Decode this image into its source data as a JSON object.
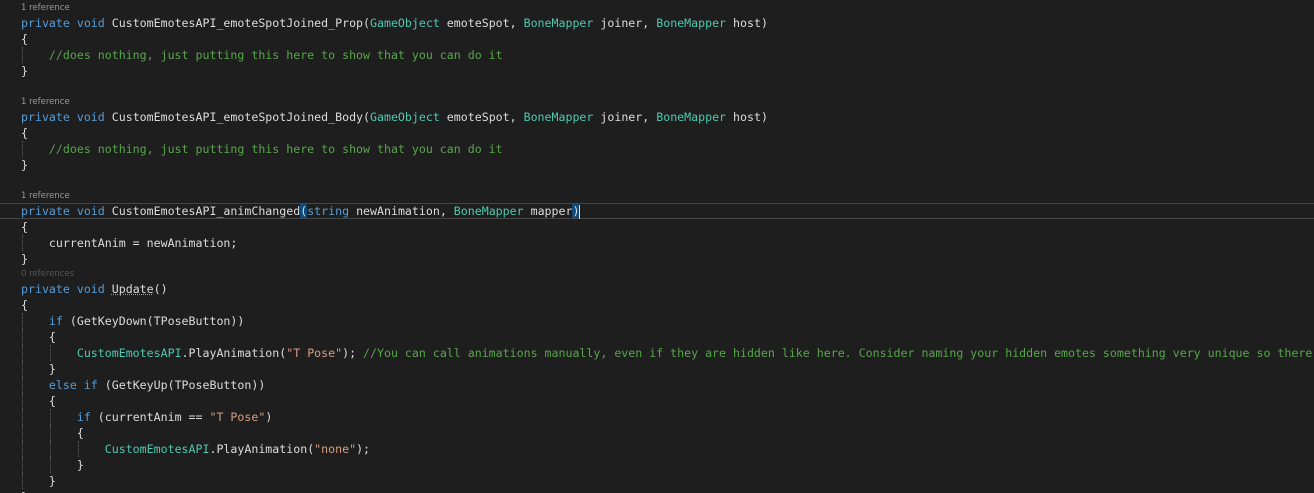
{
  "editor": {
    "theme_colors": {
      "keyword": "#569cd6",
      "type": "#4ec9b0",
      "comment": "#57a64a",
      "string": "#d69d85",
      "plain": "#dcdcdc",
      "background": "#1e1e1e"
    },
    "lines": [
      {
        "kind": "lens",
        "text": "1 reference"
      },
      {
        "kind": "code",
        "tokens": [
          [
            "k",
            "private void "
          ],
          [
            "p",
            "CustomEmotesAPI_emoteSpotJoined_Prop("
          ],
          [
            "t",
            "GameObject"
          ],
          [
            "p",
            " emoteSpot, "
          ],
          [
            "t",
            "BoneMapper"
          ],
          [
            "p",
            " joiner, "
          ],
          [
            "t",
            "BoneMapper"
          ],
          [
            "p",
            " host)"
          ]
        ]
      },
      {
        "kind": "code",
        "tokens": [
          [
            "p",
            "{"
          ]
        ]
      },
      {
        "kind": "code",
        "tokens": [
          [
            "p",
            "    "
          ],
          [
            "c",
            "//does nothing, just putting this here to show that you can do it"
          ]
        ]
      },
      {
        "kind": "code",
        "tokens": [
          [
            "p",
            "}"
          ]
        ]
      },
      {
        "kind": "code",
        "tokens": []
      },
      {
        "kind": "lens",
        "text": "1 reference"
      },
      {
        "kind": "code",
        "tokens": [
          [
            "k",
            "private void "
          ],
          [
            "p",
            "CustomEmotesAPI_emoteSpotJoined_Body("
          ],
          [
            "t",
            "GameObject"
          ],
          [
            "p",
            " emoteSpot, "
          ],
          [
            "t",
            "BoneMapper"
          ],
          [
            "p",
            " joiner, "
          ],
          [
            "t",
            "BoneMapper"
          ],
          [
            "p",
            " host)"
          ]
        ]
      },
      {
        "kind": "code",
        "tokens": [
          [
            "p",
            "{"
          ]
        ]
      },
      {
        "kind": "code",
        "tokens": [
          [
            "p",
            "    "
          ],
          [
            "c",
            "//does nothing, just putting this here to show that you can do it"
          ]
        ]
      },
      {
        "kind": "code",
        "tokens": [
          [
            "p",
            "}"
          ]
        ]
      },
      {
        "kind": "code",
        "tokens": []
      },
      {
        "kind": "lens",
        "text": "1 reference"
      },
      {
        "kind": "code",
        "current": true,
        "tokens": [
          [
            "k",
            "private void "
          ],
          [
            "p",
            "CustomEmotesAPI_animChanged"
          ],
          [
            "bm",
            "("
          ],
          [
            "k",
            "string"
          ],
          [
            "p",
            " newAnimation, "
          ],
          [
            "t",
            "BoneMapper"
          ],
          [
            "p",
            " mapper"
          ],
          [
            "bm",
            ")"
          ],
          [
            "caret",
            ""
          ]
        ]
      },
      {
        "kind": "code",
        "tokens": [
          [
            "p",
            "{"
          ]
        ]
      },
      {
        "kind": "code",
        "tokens": [
          [
            "p",
            "    currentAnim = newAnimation;"
          ]
        ]
      },
      {
        "kind": "code",
        "tokens": [
          [
            "p",
            "}"
          ]
        ]
      },
      {
        "kind": "lens",
        "dim": true,
        "text": "0 references"
      },
      {
        "kind": "code",
        "tokens": [
          [
            "k",
            "private void "
          ],
          [
            "u",
            "Update"
          ],
          [
            "p",
            "()"
          ]
        ]
      },
      {
        "kind": "code",
        "tokens": [
          [
            "p",
            "{"
          ]
        ]
      },
      {
        "kind": "code",
        "tokens": [
          [
            "p",
            "    "
          ],
          [
            "k",
            "if"
          ],
          [
            "p",
            " (GetKeyDown(TPoseButton))"
          ]
        ]
      },
      {
        "kind": "code",
        "tokens": [
          [
            "p",
            "    {"
          ]
        ]
      },
      {
        "kind": "code",
        "tokens": [
          [
            "p",
            "        "
          ],
          [
            "t",
            "CustomEmotesAPI"
          ],
          [
            "p",
            ".PlayAnimation("
          ],
          [
            "s",
            "\"T Pose\""
          ],
          [
            "p",
            "); "
          ],
          [
            "c",
            "//You can call animations manually, even if they are hidden like here. Consider naming your hidden emotes something very unique so there"
          ]
        ]
      },
      {
        "kind": "code",
        "tokens": [
          [
            "p",
            "    }"
          ]
        ]
      },
      {
        "kind": "code",
        "tokens": [
          [
            "p",
            "    "
          ],
          [
            "k",
            "else if"
          ],
          [
            "p",
            " (GetKeyUp(TPoseButton))"
          ]
        ]
      },
      {
        "kind": "code",
        "tokens": [
          [
            "p",
            "    {"
          ]
        ]
      },
      {
        "kind": "code",
        "tokens": [
          [
            "p",
            "        "
          ],
          [
            "k",
            "if"
          ],
          [
            "p",
            " (currentAnim == "
          ],
          [
            "s",
            "\"T Pose\""
          ],
          [
            "p",
            ")"
          ]
        ]
      },
      {
        "kind": "code",
        "tokens": [
          [
            "p",
            "        {"
          ]
        ]
      },
      {
        "kind": "code",
        "tokens": [
          [
            "p",
            "            "
          ],
          [
            "t",
            "CustomEmotesAPI"
          ],
          [
            "p",
            ".PlayAnimation("
          ],
          [
            "s",
            "\"none\""
          ],
          [
            "p",
            ");"
          ]
        ]
      },
      {
        "kind": "code",
        "tokens": [
          [
            "p",
            "        }"
          ]
        ]
      },
      {
        "kind": "code",
        "tokens": [
          [
            "p",
            "    }"
          ]
        ]
      },
      {
        "kind": "code",
        "tokens": [
          [
            "p",
            "}"
          ]
        ]
      }
    ]
  }
}
